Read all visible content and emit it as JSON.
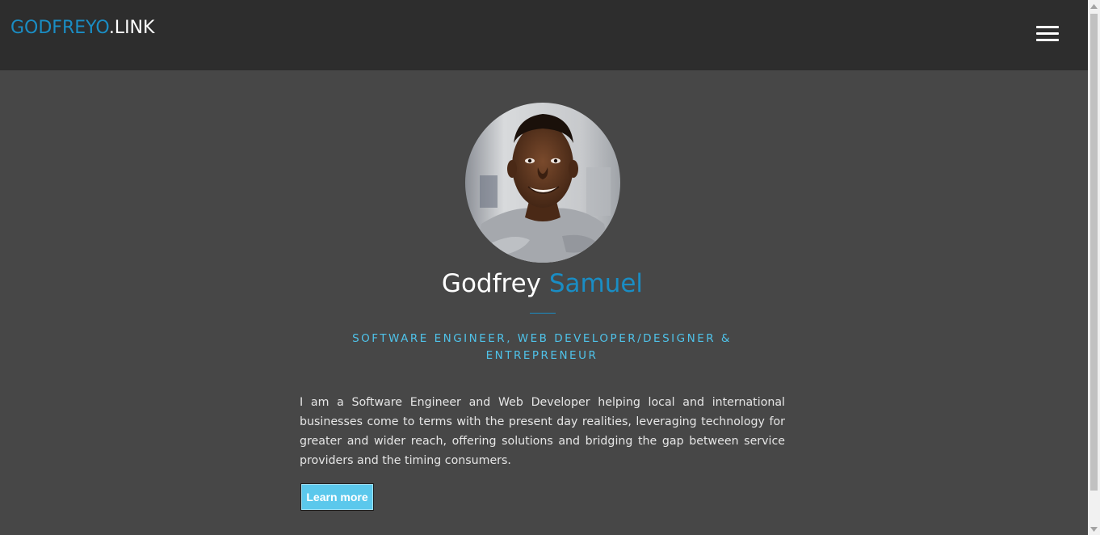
{
  "header": {
    "brand_part1": "GODFREYO",
    "brand_part2": ".LINK",
    "menu_icon": "hamburger-menu-icon"
  },
  "hero": {
    "avatar_alt": "Godfrey Samuel",
    "first_name": "Godfrey",
    "last_name": "Samuel",
    "tagline_line1": "SOFTWARE ENGINEER, WEB DEVELOPER/DESIGNER &",
    "tagline_line2": "ENTREPRENEUR",
    "bio": "I am a Software Engineer and Web Developer helping local and international businesses come to terms with the present day realities, leveraging technology for greater and wider reach, offering solutions and bridging the gap between service providers and the timing consumers.",
    "button_label": "Learn more"
  },
  "colors": {
    "accent": "#1a8dc4",
    "tagline": "#4fc3ea",
    "header_bg": "#2d2d2d",
    "page_bg": "#474747",
    "button_bg": "#5bc8ec"
  }
}
